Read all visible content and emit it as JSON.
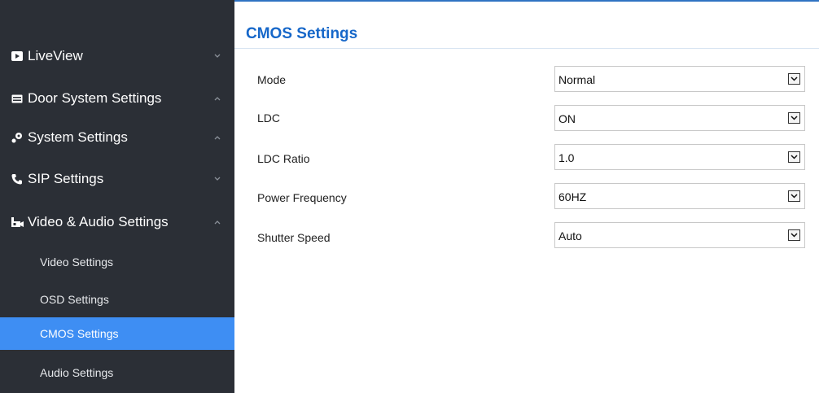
{
  "sidebar": {
    "items": [
      {
        "label": "LiveView",
        "icon": "play-icon",
        "state": "collapsed"
      },
      {
        "label": "Door System Settings",
        "icon": "keyboard-icon",
        "state": "expanded"
      },
      {
        "label": "System Settings",
        "icon": "gears-icon",
        "state": "expanded"
      },
      {
        "label": "SIP Settings",
        "icon": "phone-icon",
        "state": "collapsed"
      },
      {
        "label": "Video & Audio Settings",
        "icon": "camera-icon",
        "state": "expanded"
      }
    ],
    "subitems": [
      {
        "label": "Video Settings",
        "active": false
      },
      {
        "label": "OSD Settings",
        "active": false
      },
      {
        "label": "CMOS Settings",
        "active": true
      },
      {
        "label": "Audio Settings",
        "active": false
      }
    ]
  },
  "main": {
    "title": "CMOS Settings",
    "fields": [
      {
        "label": "Mode",
        "value": "Normal"
      },
      {
        "label": "LDC",
        "value": "ON"
      },
      {
        "label": "LDC Ratio",
        "value": "1.0"
      },
      {
        "label": "Power Frequency",
        "value": "60HZ"
      },
      {
        "label": "Shutter Speed",
        "value": "Auto"
      }
    ]
  },
  "colors": {
    "sidebar_bg": "#2b2f36",
    "active_bg": "#3e8ef3",
    "title": "#1667c9"
  }
}
